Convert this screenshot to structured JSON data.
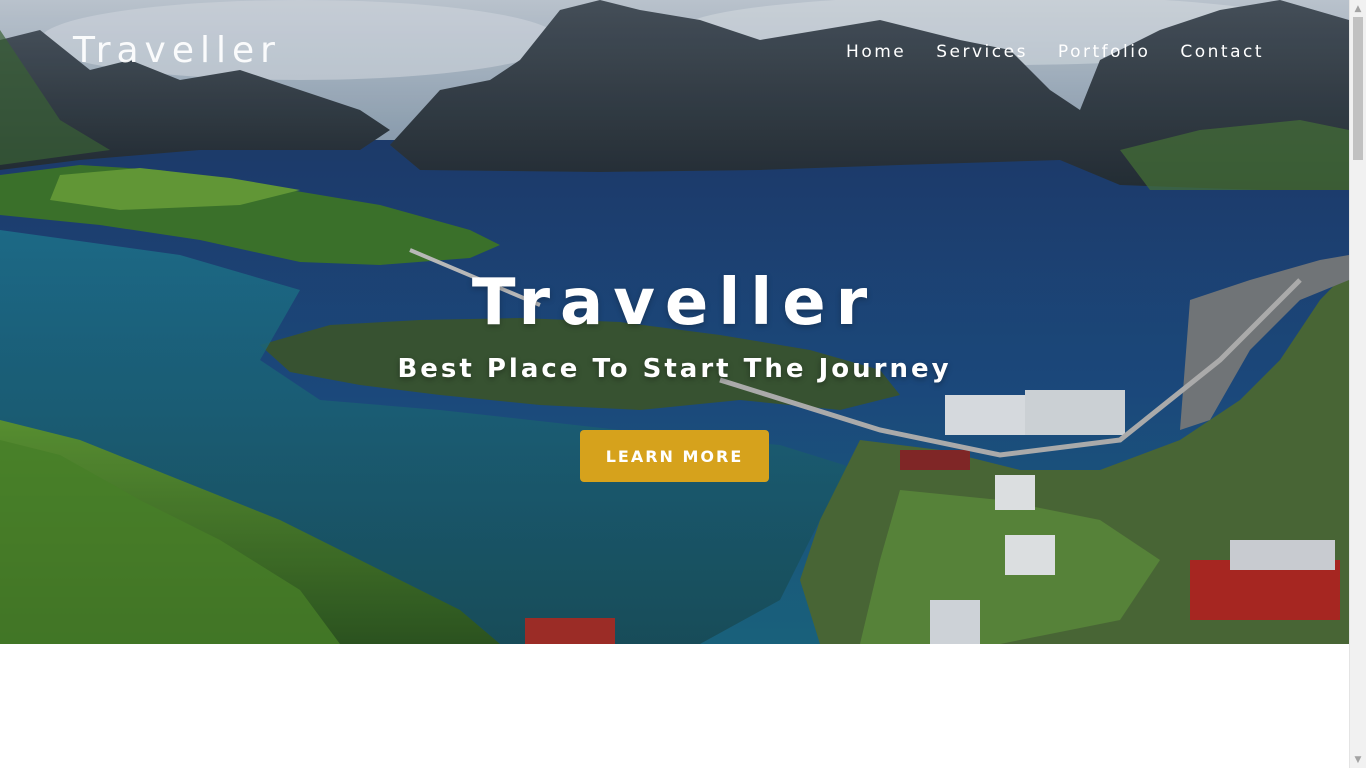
{
  "brand": {
    "name": "Traveller"
  },
  "nav": {
    "items": [
      {
        "label": "Home"
      },
      {
        "label": "Services"
      },
      {
        "label": "Portfolio"
      },
      {
        "label": "Contact"
      }
    ]
  },
  "hero": {
    "title": "Traveller",
    "subtitle": "Best Place To Start The Journey",
    "cta_label": "LEARN MORE",
    "background_image": "aerial-fjord-landscape"
  },
  "colors": {
    "accent": "#d6a21c",
    "text_light": "#ffffff",
    "below_fold": "#ffffff"
  },
  "scrollbar": {
    "up_icon": "chevron-up-icon",
    "down_icon": "chevron-down-icon"
  }
}
